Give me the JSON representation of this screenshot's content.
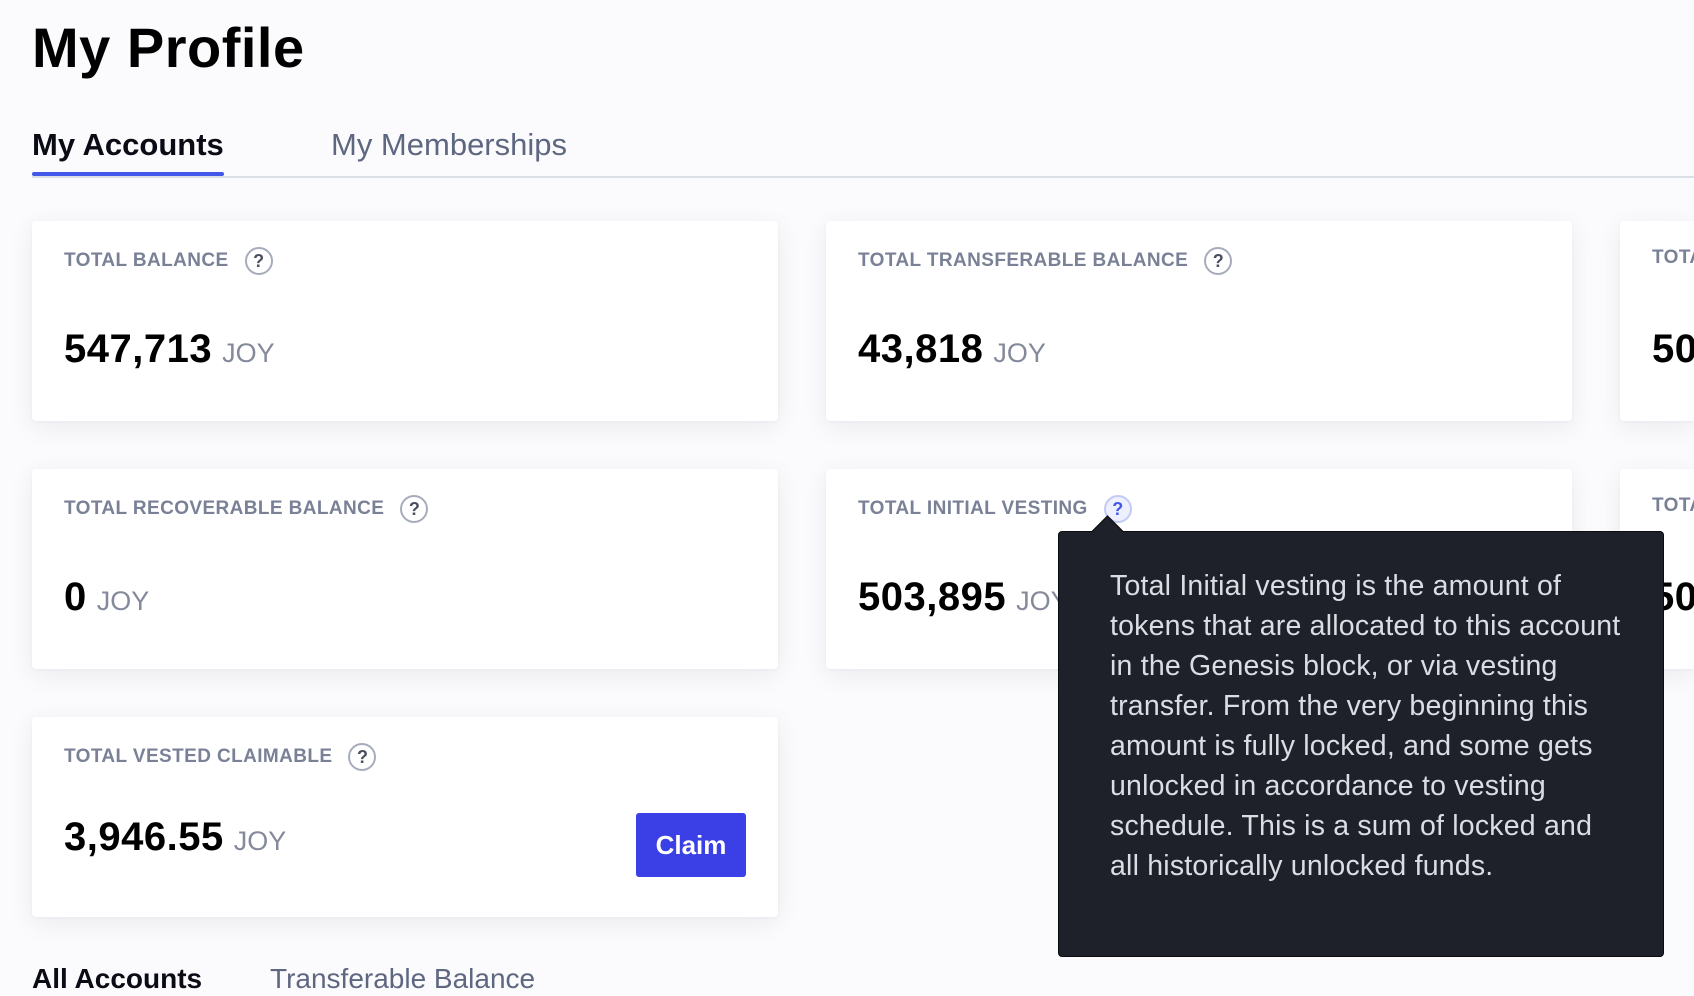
{
  "page": {
    "title": "My Profile"
  },
  "tabs": [
    {
      "label": "My Accounts",
      "active": true
    },
    {
      "label": "My Memberships",
      "active": false
    }
  ],
  "cards": {
    "total_balance": {
      "label": "TOTAL BALANCE",
      "value": "547,713",
      "unit": "JOY"
    },
    "total_transferable_balance": {
      "label": "TOTAL TRANSFERABLE BALANCE",
      "value": "43,818",
      "unit": "JOY"
    },
    "total_col3_top": {
      "label": "TOTA",
      "value": "50"
    },
    "total_recoverable_balance": {
      "label": "TOTAL RECOVERABLE BALANCE",
      "value": "0",
      "unit": "JOY"
    },
    "total_initial_vesting": {
      "label": "TOTAL INITIAL VESTING",
      "value": "503,895",
      "unit": "JOY"
    },
    "total_col3_middle": {
      "label": "TOTA",
      "value": "50"
    },
    "total_vested_claimable": {
      "label": "TOTAL VESTED CLAIMABLE",
      "value": "3,946.55",
      "unit": "JOY",
      "button_label": "Claim"
    }
  },
  "help_icon_glyph": "?",
  "tooltip": {
    "text": "Total Initial vesting is the amount of tokens that are allocated to this account in the Genesis block, or via vesting transfer. From the very beginning this amount is fully locked, and some gets unlocked in accordance to vesting schedule. This is a sum of locked and all historically unlocked funds."
  },
  "bottom_tabs": [
    {
      "label": "All Accounts",
      "active": true
    },
    {
      "label": "Transferable Balance",
      "active": false
    }
  ],
  "colors": {
    "accent": "#4158ea",
    "claim_button": "#3a3fe6",
    "tooltip_background": "#1e2129",
    "label_gray": "#7a8197"
  }
}
